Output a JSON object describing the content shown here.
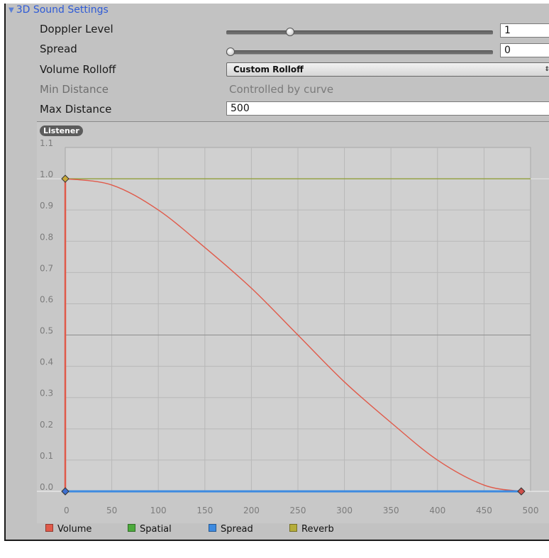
{
  "section": {
    "title": "3D Sound Settings"
  },
  "fields": {
    "doppler": {
      "label": "Doppler Level",
      "value": "1",
      "slider_fraction": 0.23
    },
    "spread": {
      "label": "Spread",
      "value": "0",
      "slider_fraction": 0.0
    },
    "volume_rolloff": {
      "label": "Volume Rolloff",
      "value": "Custom Rolloff"
    },
    "min_distance": {
      "label": "Min Distance",
      "value": "Controlled by curve"
    },
    "max_distance": {
      "label": "Max Distance",
      "value": "500"
    }
  },
  "graph": {
    "badge": "Listener",
    "y_ticks": [
      "1.1",
      "1.0",
      "0.9",
      "0.8",
      "0.7",
      "0.6",
      "0.5",
      "0.4",
      "0.3",
      "0.2",
      "0.1",
      "0.0"
    ],
    "x_ticks": [
      "0",
      "50",
      "100",
      "150",
      "200",
      "250",
      "300",
      "350",
      "400",
      "450",
      "500"
    ]
  },
  "legend": [
    {
      "label": "Volume",
      "color": "#e05a4a"
    },
    {
      "label": "Spatial",
      "color": "#4caa3c"
    },
    {
      "label": "Spread",
      "color": "#3d8ae0"
    },
    {
      "label": "Reverb",
      "color": "#b5ad3a"
    }
  ],
  "chart_data": {
    "type": "line",
    "x_range": [
      0,
      500
    ],
    "y_range": [
      0,
      1.1
    ],
    "series": [
      {
        "name": "Volume",
        "color": "#e05a4a",
        "x": [
          0,
          50,
          100,
          150,
          200,
          250,
          300,
          350,
          400,
          450,
          490
        ],
        "y": [
          1.0,
          0.98,
          0.9,
          0.78,
          0.65,
          0.5,
          0.35,
          0.22,
          0.1,
          0.02,
          0.0
        ]
      },
      {
        "name": "Spatial",
        "color": "#4caa3c",
        "x": [
          0,
          500
        ],
        "y": [
          1.0,
          1.0
        ]
      },
      {
        "name": "Spread",
        "color": "#3d8ae0",
        "x": [
          0,
          490
        ],
        "y": [
          0.0,
          0.0
        ]
      },
      {
        "name": "Reverb",
        "color": "#b5ad3a",
        "x": [
          0,
          500
        ],
        "y": [
          1.0,
          1.0
        ]
      }
    ]
  }
}
